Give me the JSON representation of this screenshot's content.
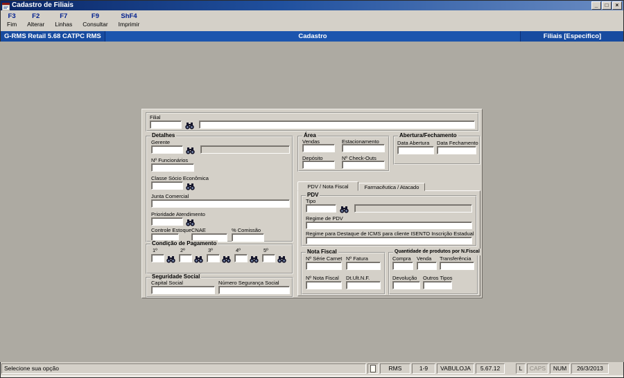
{
  "window": {
    "title": "Cadastro de Filiais",
    "controls": {
      "minimize_glyph": "_",
      "restore_glyph": "□",
      "close_glyph": "×"
    }
  },
  "toolbar": {
    "items": [
      {
        "key": "F3",
        "label": "Fim"
      },
      {
        "key": "F2",
        "label": "Alterar"
      },
      {
        "key": "F7",
        "label": "Linhas"
      },
      {
        "key": "F9",
        "label": "Consultar"
      },
      {
        "key": "ShF4",
        "label": "Imprimir"
      }
    ]
  },
  "header": {
    "app": "G-RMS Retail 5.68 CATPC RMS",
    "module": "Cadastro",
    "screen": "Filiais [Especifico]"
  },
  "colors": {
    "header_blue": "#1b55ae",
    "titlebar_gradient_from": "#0b2766",
    "titlebar_gradient_to": "#6a8cc2",
    "chrome_gray": "#d4d0c8",
    "workspace_gray": "#adaaa2",
    "toolbar_key_blue": "#001f8e"
  },
  "form": {
    "filial": {
      "label": "Filial",
      "code": "",
      "name": ""
    },
    "detalhes": {
      "title": "Detalhes",
      "gerente": {
        "label": "Gerente",
        "code": "",
        "name": ""
      },
      "num_funcionarios": {
        "label": "Nº Funcionários",
        "value": ""
      },
      "classe_socio_economica": {
        "label": "Classe Sócio Econômica",
        "value": ""
      },
      "junta_comercial": {
        "label": "Junta Comercial",
        "value": ""
      },
      "prioridade_atendimento": {
        "label": "Prioridade Atendimento",
        "value": ""
      },
      "controle_estoque": {
        "label": "Controle Estoque",
        "value": ""
      },
      "cnae": {
        "label": "CNAE",
        "value": ""
      },
      "comissao": {
        "label": "% Comissão",
        "value": ""
      }
    },
    "condicao_pagamento": {
      "title": "Condição de Pagamento",
      "slots": [
        {
          "label": "1º",
          "value": ""
        },
        {
          "label": "2º",
          "value": ""
        },
        {
          "label": "3º",
          "value": ""
        },
        {
          "label": "4º",
          "value": ""
        },
        {
          "label": "5º",
          "value": ""
        }
      ]
    },
    "seguridade_social": {
      "title": "Seguridade Social",
      "capital_social": {
        "label": "Capital Social",
        "value": ""
      },
      "numero_seguranca_social": {
        "label": "Número Segurança Social",
        "value": ""
      }
    },
    "area": {
      "title": "Área",
      "vendas": {
        "label": "Vendas",
        "value": ""
      },
      "estacionamento": {
        "label": "Estacionamento",
        "value": ""
      },
      "deposito": {
        "label": "Depósito",
        "value": ""
      },
      "check_outs": {
        "label": "Nº Check-Outs",
        "value": ""
      }
    },
    "abertura_fechamento": {
      "title": "Abertura/Fechamento",
      "data_abertura": {
        "label": "Data Abertura",
        "value": ""
      },
      "data_fechamento": {
        "label": "Data Fechamento",
        "value": ""
      }
    },
    "tabs": [
      {
        "label": "PDV / Nota Fiscal",
        "selected": true
      },
      {
        "label": "Farmacêutica / Atacado",
        "selected": false
      }
    ],
    "pdv": {
      "title": "PDV",
      "tipo": {
        "label": "Tipo",
        "code": "",
        "name": ""
      },
      "regime_pdv": {
        "label": "Regime de PDV",
        "value": ""
      },
      "regime_icms": {
        "label": "Regime para Destaque de ICMS para cliente ISENTO Inscrição Estadual",
        "value": ""
      }
    },
    "nota_fiscal": {
      "title": "Nota Fiscal",
      "serie_carnet": {
        "label": "Nº Série Carnet",
        "value": ""
      },
      "fatura": {
        "label": "Nº Fatura",
        "value": ""
      },
      "nota_fiscal": {
        "label": "Nº Nota Fiscal",
        "value": ""
      },
      "dt_ult_nf": {
        "label": "Dt.Ult.N.F.",
        "value": ""
      }
    },
    "quantidade_nf": {
      "title": "Quantidade de produtos por N.Fiscal",
      "compra": {
        "label": "Compra",
        "value": ""
      },
      "venda": {
        "label": "Venda",
        "value": ""
      },
      "transferencia": {
        "label": "Transferência",
        "value": ""
      },
      "devolucao": {
        "label": "Devolução",
        "value": ""
      },
      "outros_tipos": {
        "label": "Outros Tipos",
        "value": ""
      }
    }
  },
  "statusbar": {
    "message": "Selecione sua opção",
    "system": "RMS",
    "range": "1-9",
    "station": "VABULOJA",
    "version": "5.67.12",
    "lock": "L",
    "caps": "CAPS",
    "num": "NUM",
    "date": "26/3/2013"
  }
}
